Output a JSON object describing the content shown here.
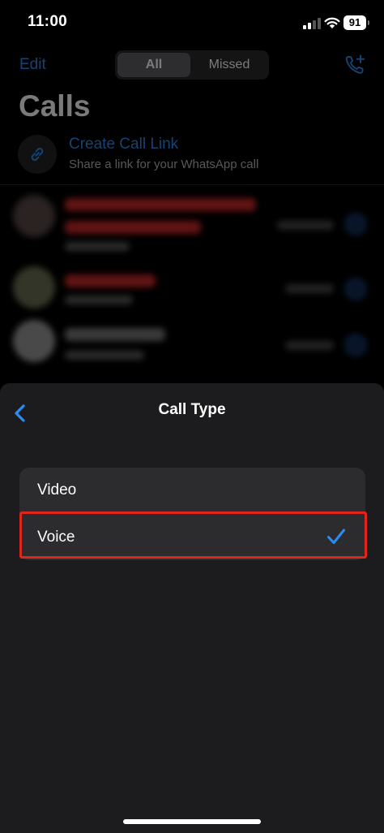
{
  "status_bar": {
    "time": "11:00",
    "battery": "91"
  },
  "header": {
    "edit_label": "Edit",
    "tabs": [
      "All",
      "Missed"
    ],
    "selected_tab": "All",
    "title": "Calls"
  },
  "call_link": {
    "title": "Create Call Link",
    "subtitle": "Share a link for your WhatsApp call"
  },
  "sheet": {
    "title": "Call Type",
    "options": [
      {
        "label": "Video",
        "selected": false
      },
      {
        "label": "Voice",
        "selected": true
      }
    ],
    "highlight_color": "#e0261c"
  },
  "colors": {
    "accent": "#2a8cf5",
    "background": "#000000",
    "sheet": "#1c1c1e",
    "missed_call": "#cc2a2a"
  }
}
